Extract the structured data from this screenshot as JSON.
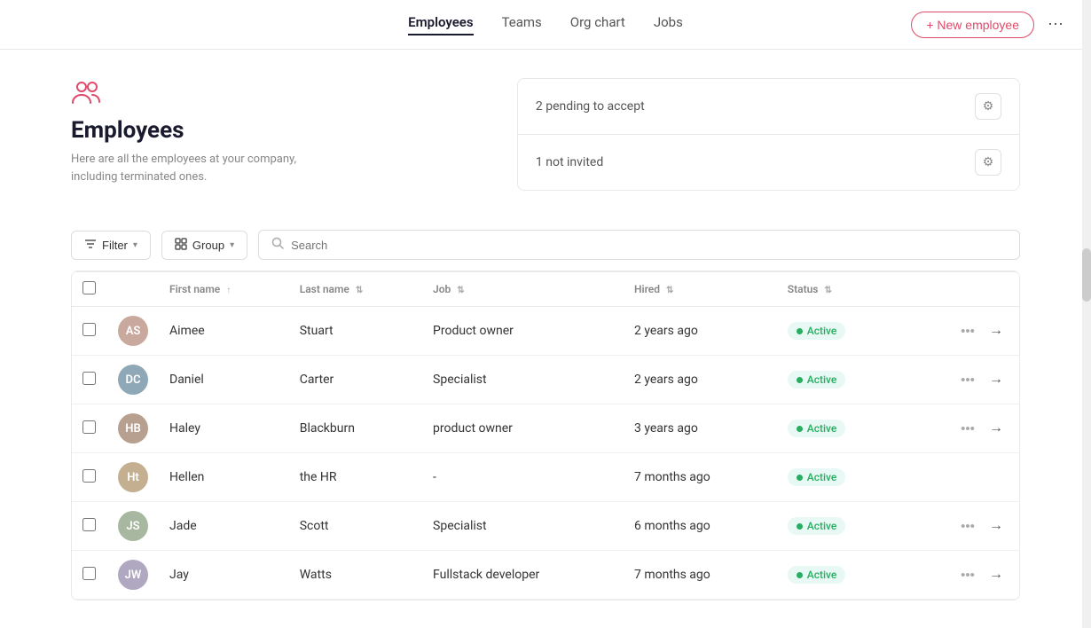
{
  "nav": {
    "tabs": [
      {
        "id": "employees",
        "label": "Employees",
        "active": true
      },
      {
        "id": "teams",
        "label": "Teams",
        "active": false
      },
      {
        "id": "org-chart",
        "label": "Org chart",
        "active": false
      },
      {
        "id": "jobs",
        "label": "Jobs",
        "active": false
      }
    ],
    "new_employee_label": "+ New employee",
    "more_icon": "⋯"
  },
  "page": {
    "title": "Employees",
    "subtitle": "Here are all the employees at your company,\nincluding terminated ones.",
    "info_cards": [
      {
        "text": "2 pending to accept"
      },
      {
        "text": "1 not invited"
      }
    ]
  },
  "toolbar": {
    "filter_label": "Filter",
    "group_label": "Group",
    "search_placeholder": "Search"
  },
  "table": {
    "columns": [
      {
        "id": "first-name",
        "label": "First name",
        "sortable": true,
        "sorted": true
      },
      {
        "id": "last-name",
        "label": "Last name",
        "sortable": true
      },
      {
        "id": "job",
        "label": "Job",
        "sortable": true
      },
      {
        "id": "hired",
        "label": "Hired",
        "sortable": true
      },
      {
        "id": "status",
        "label": "Status",
        "sortable": true
      }
    ],
    "rows": [
      {
        "id": 1,
        "first_name": "Aimee",
        "last_name": "Stuart",
        "job": "Product owner",
        "hired": "2 years ago",
        "status": "Active",
        "avatar_color": "#c4a8a0"
      },
      {
        "id": 2,
        "first_name": "Daniel",
        "last_name": "Carter",
        "job": "Specialist",
        "hired": "2 years ago",
        "status": "Active",
        "avatar_color": "#8da8b8"
      },
      {
        "id": 3,
        "first_name": "Haley",
        "last_name": "Blackburn",
        "job": "product owner",
        "hired": "3 years ago",
        "status": "Active",
        "avatar_color": "#b8a090"
      },
      {
        "id": 4,
        "first_name": "Hellen",
        "last_name": "the HR",
        "job": "-",
        "hired": "7 months ago",
        "status": "Active",
        "avatar_color": "#c4b8a0"
      },
      {
        "id": 5,
        "first_name": "Jade",
        "last_name": "Scott",
        "job": "Specialist",
        "hired": "6 months ago",
        "status": "Active",
        "avatar_color": "#a8b8a0"
      },
      {
        "id": 6,
        "first_name": "Jay",
        "last_name": "Watts",
        "job": "Fullstack developer",
        "hired": "7 months ago",
        "status": "Active",
        "avatar_color": "#b0a8c0"
      }
    ]
  },
  "icons": {
    "filter": "⊟",
    "group": "⊞",
    "search": "🔍",
    "settings": "⚙",
    "more": "•••",
    "arrow_right": "→",
    "sort_up": "↑",
    "sort": "⇅",
    "chevron_down": "▾",
    "plus": "+"
  }
}
